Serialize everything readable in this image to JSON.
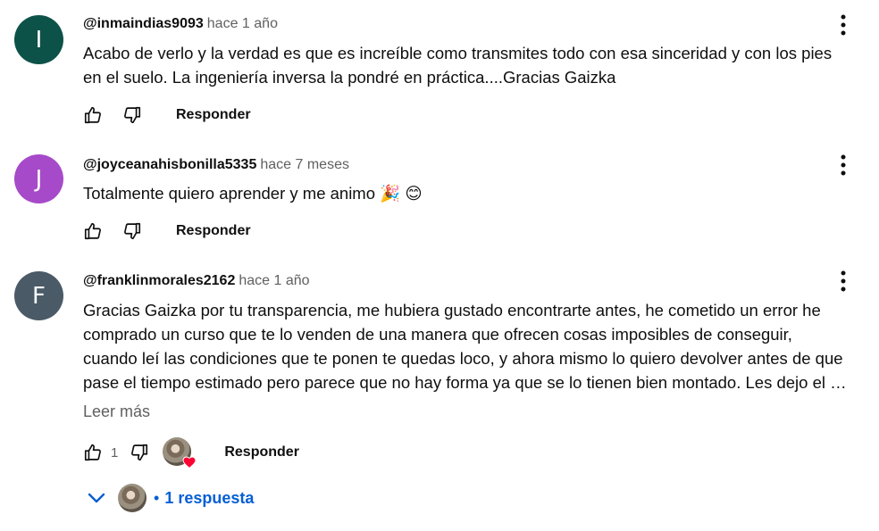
{
  "comments": [
    {
      "avatar_letter": "I",
      "avatar_color": "#0d5248",
      "author": "@inmaindias9093",
      "time": "hace 1 año",
      "lines": [
        "Acabo de verlo y la verdad es que es increíble como transmites todo con esa sinceridad y con los pies",
        "en el suelo. La ingeniería inversa la pondré en práctica....Gracias Gaizka"
      ],
      "reply_label": "Responder"
    },
    {
      "avatar_letter": "J",
      "avatar_color": "#a64ac9",
      "author": "@joyceanahisbonilla5335",
      "time": "hace 7 meses",
      "lines": [
        "Totalmente quiero aprender y me animo 🎉 😊"
      ],
      "reply_label": "Responder"
    },
    {
      "avatar_letter": "F",
      "avatar_color": "#4a5a66",
      "author": "@franklinmorales2162",
      "time": "hace 1 año",
      "lines": [
        "Gracias Gaizka por tu transparencia, me hubiera gustado encontrarte antes, he cometido un error he",
        "comprado un curso que te lo venden de una manera que ofrecen cosas imposibles de conseguir,",
        "cuando leí las condiciones que te ponen te quedas loco, y ahora mismo lo quiero devolver antes de que",
        "pase el tiempo estimado pero parece que no hay forma ya que se lo tienen bien montado. Les dejo el …"
      ],
      "read_more": "Leer más",
      "like_count": "1",
      "reply_label": "Responder",
      "replies_label": "1 respuesta",
      "replies_separator": "•"
    }
  ],
  "icons": {
    "like": "thumbs-up-icon",
    "dislike": "thumbs-down-icon",
    "menu": "more-vert-icon",
    "expand": "chevron-down-icon",
    "creator_heart": "heart-icon"
  },
  "colors": {
    "link_blue": "#065fd4",
    "heart_red": "#ff0033",
    "secondary_text": "#606060"
  }
}
